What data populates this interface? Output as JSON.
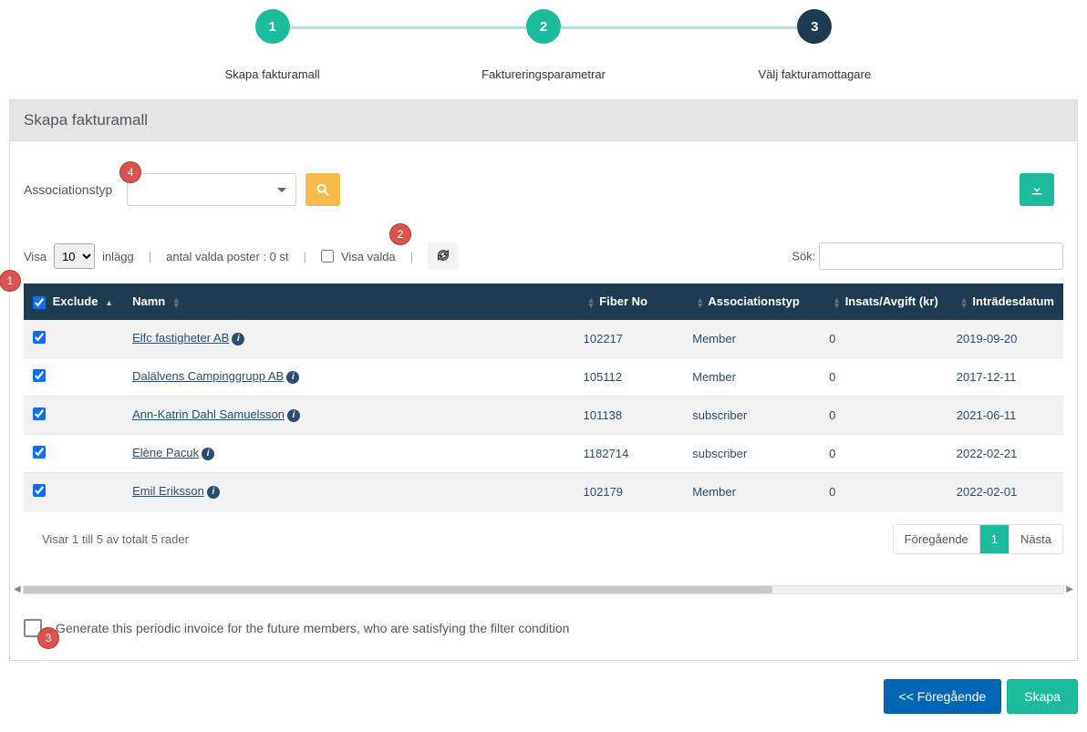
{
  "stepper": {
    "steps": [
      {
        "num": "1",
        "label": "Skapa fakturamall",
        "dark": false
      },
      {
        "num": "2",
        "label": "Faktureringsparametrar",
        "dark": false
      },
      {
        "num": "3",
        "label": "Välj fakturamottagare",
        "dark": true
      }
    ]
  },
  "panel_title": "Skapa fakturamall",
  "filters": {
    "assoc_label": "Associationstyp"
  },
  "badges": {
    "b1": "1",
    "b2": "2",
    "b3": "3",
    "b4": "4"
  },
  "controls": {
    "visa": "Visa",
    "page_size": "10",
    "inlagg": "inlägg",
    "selected_count": "antal valda poster : 0 st",
    "visa_valda": "Visa valda",
    "sok": "Sök:"
  },
  "columns": {
    "exclude": "Exclude",
    "namn": "Namn",
    "fiber": "Fiber No",
    "assoc": "Associationstyp",
    "insats": "Insats/Avgift (kr)",
    "intrades": "Inträdesdatum"
  },
  "rows": [
    {
      "name": "Elfc fastigheter AB",
      "fiber": "102217",
      "assoc": "Member",
      "insats": "0",
      "date": "2019-09-20"
    },
    {
      "name": "Dalälvens Campinggrupp AB",
      "fiber": "105112",
      "assoc": "Member",
      "insats": "0",
      "date": "2017-12-11"
    },
    {
      "name": "Ann-Katrin Dahl Samuelsson",
      "fiber": "101138",
      "assoc": "subscriber",
      "insats": "0",
      "date": "2021-06-11"
    },
    {
      "name": "Elène Pacuk",
      "fiber": "1182714",
      "assoc": "subscriber",
      "insats": "0",
      "date": "2022-02-21"
    },
    {
      "name": "Emil Eriksson",
      "fiber": "102179",
      "assoc": "Member",
      "insats": "0",
      "date": "2022-02-01"
    }
  ],
  "footer": {
    "info": "Visar 1 till 5 av totalt 5 rader",
    "prev": "Föregående",
    "page": "1",
    "next": "Nästa"
  },
  "future_checkbox_label": "Generate this periodic invoice for the future members, who are satisfying the filter condition",
  "buttons": {
    "prev": "<< Föregående",
    "create": "Skapa"
  }
}
